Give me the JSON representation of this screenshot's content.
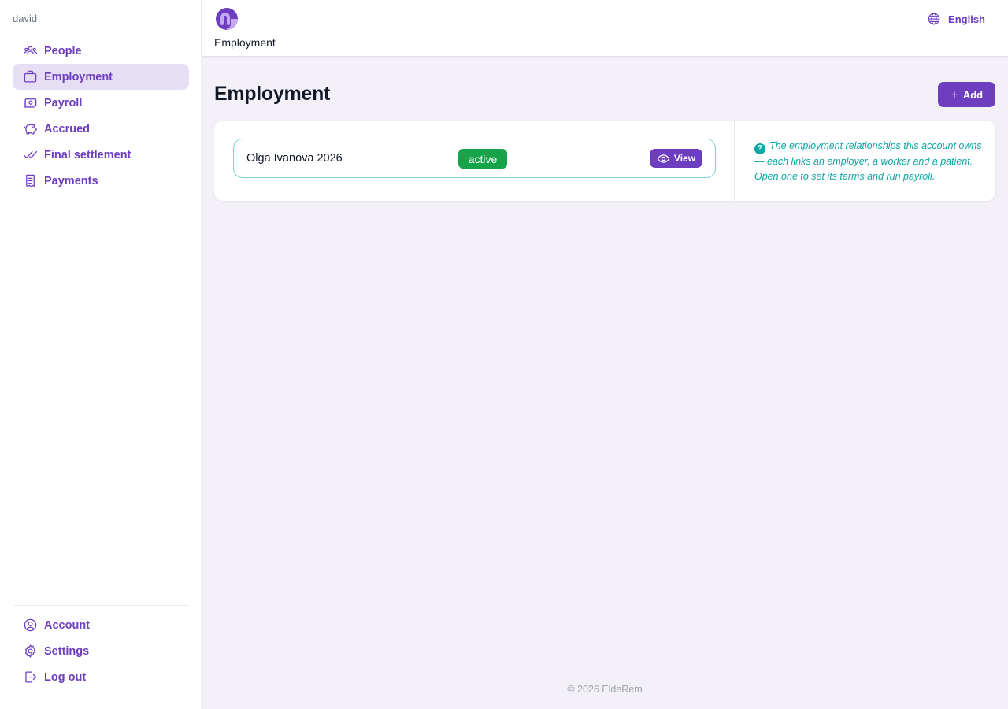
{
  "user": {
    "name": "david"
  },
  "sidebar": {
    "items": [
      {
        "label": "People",
        "icon": "people-icon"
      },
      {
        "label": "Employment",
        "icon": "briefcase-icon",
        "active": true
      },
      {
        "label": "Payroll",
        "icon": "banknote-icon"
      },
      {
        "label": "Accrued",
        "icon": "piggy-bank-icon"
      },
      {
        "label": "Final settlement",
        "icon": "double-check-icon"
      },
      {
        "label": "Payments",
        "icon": "receipt-icon"
      }
    ],
    "bottom_items": [
      {
        "label": "Account",
        "icon": "user-circle-icon"
      },
      {
        "label": "Settings",
        "icon": "gear-icon"
      },
      {
        "label": "Log out",
        "icon": "logout-icon"
      }
    ]
  },
  "header": {
    "title": "Employment",
    "language": "English",
    "logo": "app-logo"
  },
  "main": {
    "title": "Employment",
    "add_label": "Add",
    "employments": [
      {
        "name": "Olga Ivanova 2026",
        "status": "active",
        "view_label": "View"
      }
    ],
    "help_text": "The employment relationships this account owns — each links an employer, a worker and a patient. Open one to set its terms and run payroll."
  },
  "footer": {
    "text": "© 2026 EldeRem"
  },
  "colors": {
    "accent": "#6d3fc0",
    "accent_light": "#e6def5",
    "status_active": "#16a34a",
    "help_teal": "#0ea5a4",
    "background": "#f3f0f7"
  }
}
